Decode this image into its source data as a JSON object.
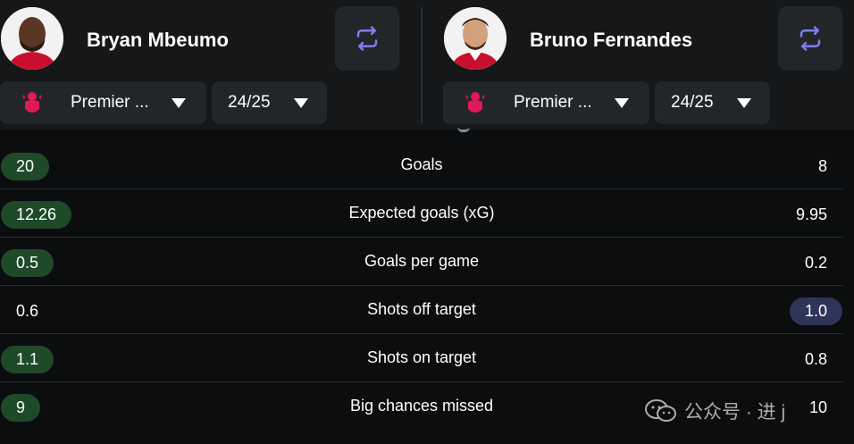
{
  "players": [
    {
      "name": "Bryan Mbeumo",
      "league": "Premier ...",
      "season": "24/25"
    },
    {
      "name": "Bruno Fernandes",
      "league": "Premier ...",
      "season": "24/25"
    }
  ],
  "stats": [
    {
      "label": "Goals",
      "left": "20",
      "right": "8",
      "winner": "left"
    },
    {
      "label": "Expected goals (xG)",
      "left": "12.26",
      "right": "9.95",
      "winner": "left"
    },
    {
      "label": "Goals per game",
      "left": "0.5",
      "right": "0.2",
      "winner": "left"
    },
    {
      "label": "Shots off target",
      "left": "0.6",
      "right": "1.0",
      "winner": "right"
    },
    {
      "label": "Shots on target",
      "left": "1.1",
      "right": "0.8",
      "winner": "left"
    },
    {
      "label": "Big chances missed",
      "left": "9",
      "right": "10",
      "winner": "left"
    }
  ],
  "watermark": {
    "text": "公众号 · 进 j"
  },
  "colors": {
    "header_bg": "#151718",
    "page_bg": "#0b0d0e",
    "control_bg": "#232628",
    "left_highlight": "#1f4a2a",
    "right_highlight": "#2f3559",
    "swap_icon": "#7b7ff0",
    "premier_league": "#e0195a"
  },
  "icons": {
    "swap": "swap-arrows-icon",
    "league": "premier-league-icon",
    "dropdown": "caret-down-icon"
  }
}
